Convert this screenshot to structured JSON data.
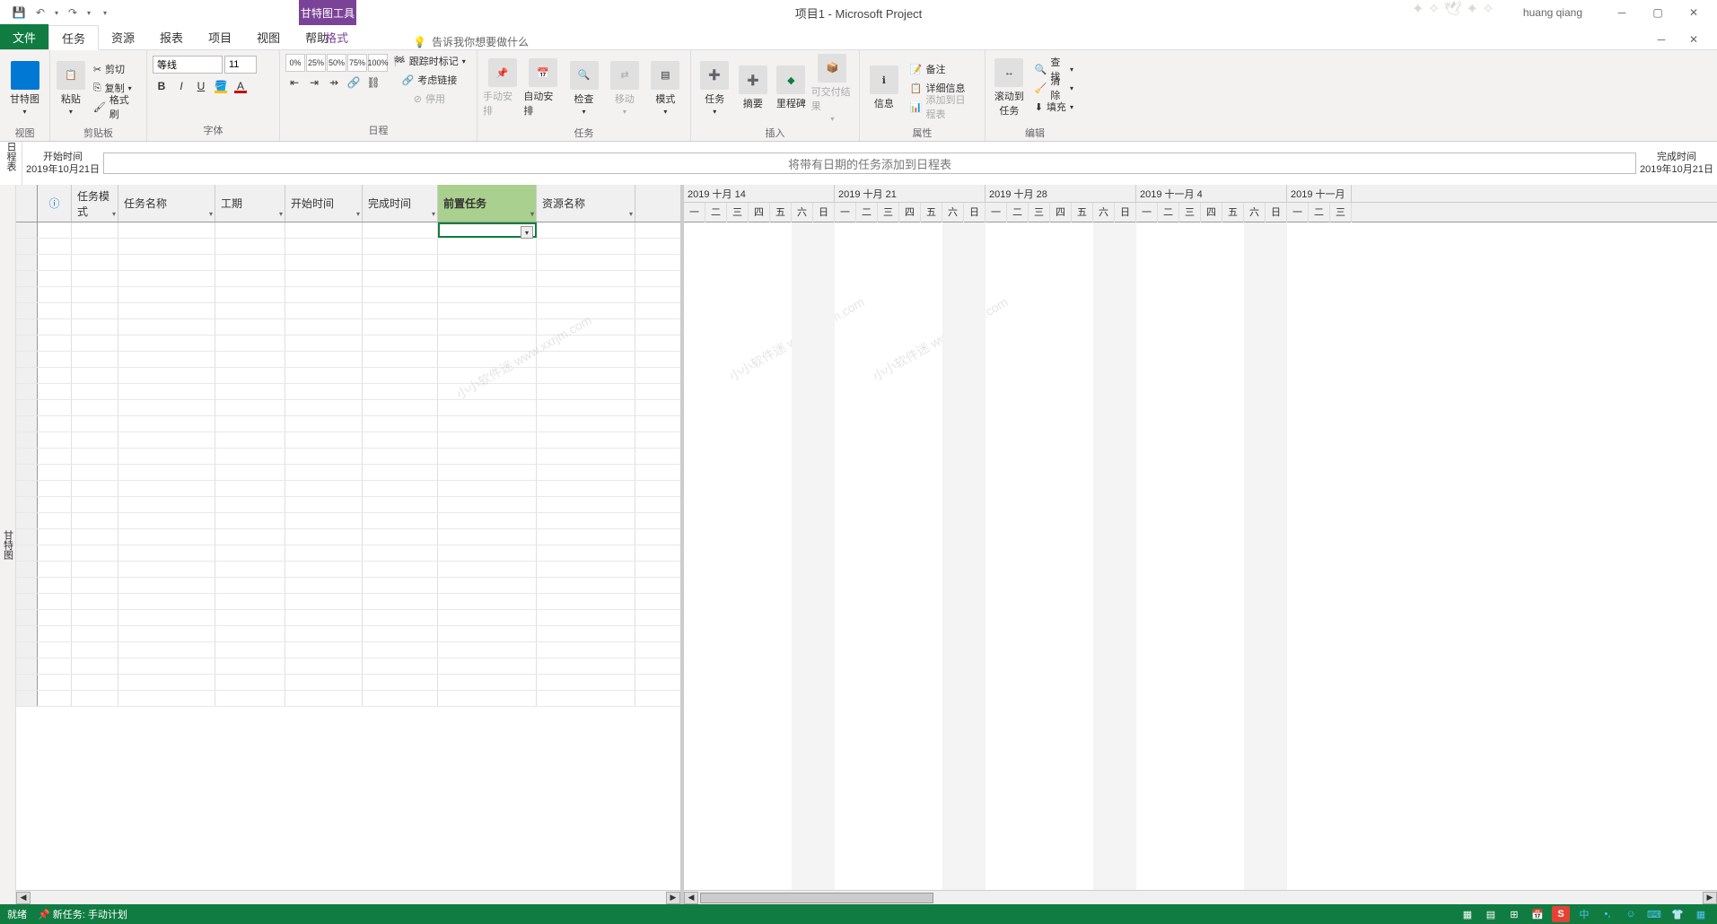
{
  "title": "项目1 - Microsoft Project",
  "user": "huang qiang",
  "gantt_tool": "甘特图工具",
  "tabs": {
    "file": "文件",
    "task": "任务",
    "resource": "资源",
    "report": "报表",
    "project": "项目",
    "view": "视图",
    "help": "帮助",
    "format": "格式"
  },
  "tell_me": "告诉我你想要做什么",
  "ribbon": {
    "view_group": "视图",
    "gantt_btn": "甘特图",
    "clipboard": "剪贴板",
    "paste": "粘贴",
    "cut": "剪切",
    "copy": "复制",
    "format_painter": "格式刷",
    "font": "字体",
    "font_name": "等线",
    "font_size": "11",
    "schedule": "日程",
    "track_mark": "跟踪时标记",
    "respect_links": "考虑链接",
    "inactivate": "停用",
    "tasks_group": "任务",
    "manual": "手动安排",
    "auto": "自动安排",
    "inspect": "检查",
    "move": "移动",
    "mode": "模式",
    "insert": "插入",
    "task_btn": "任务",
    "summary": "摘要",
    "milestone": "里程碑",
    "deliverable": "可交付结果",
    "properties": "属性",
    "information": "信息",
    "notes": "备注",
    "details": "详细信息",
    "add_timeline": "添加到日程表",
    "editing": "编辑",
    "scroll_to_task": "滚动到任务",
    "find": "查找",
    "clear": "清除",
    "fill": "填充"
  },
  "timeline": {
    "label": "日程表",
    "start_cap": "开始时间",
    "start_date": "2019年10月21日",
    "end_cap": "完成时间",
    "end_date": "2019年10月21日",
    "hint": "将带有日期的任务添加到日程表"
  },
  "gantt_label": "甘特图",
  "columns": {
    "info": "ℹ",
    "mode": "任务模式",
    "name": "任务名称",
    "duration": "工期",
    "start": "开始时间",
    "finish": "完成时间",
    "predecessors": "前置任务",
    "resources": "资源名称"
  },
  "col_widths": {
    "sel": 24,
    "info": 38,
    "mode": 52,
    "name": 108,
    "duration": 78,
    "start": 86,
    "finish": 84,
    "predecessors": 110,
    "resources": 110
  },
  "gantt_timeline": {
    "months": [
      {
        "label": "2019 十月 14",
        "days": 7
      },
      {
        "label": "2019 十月 21",
        "days": 7
      },
      {
        "label": "2019 十月 28",
        "days": 7
      },
      {
        "label": "2019 十一月 4",
        "days": 7
      },
      {
        "label": "2019 十一月",
        "days": 3
      }
    ],
    "day_labels": [
      "一",
      "二",
      "三",
      "四",
      "五",
      "六",
      "日"
    ]
  },
  "status": {
    "ready": "就绪",
    "new_task": "新任务: 手动计划"
  },
  "pct_buttons": [
    "0%",
    "25%",
    "50%",
    "75%",
    "100%"
  ],
  "watermark": "小小软件迷 www.xxrjm.com"
}
